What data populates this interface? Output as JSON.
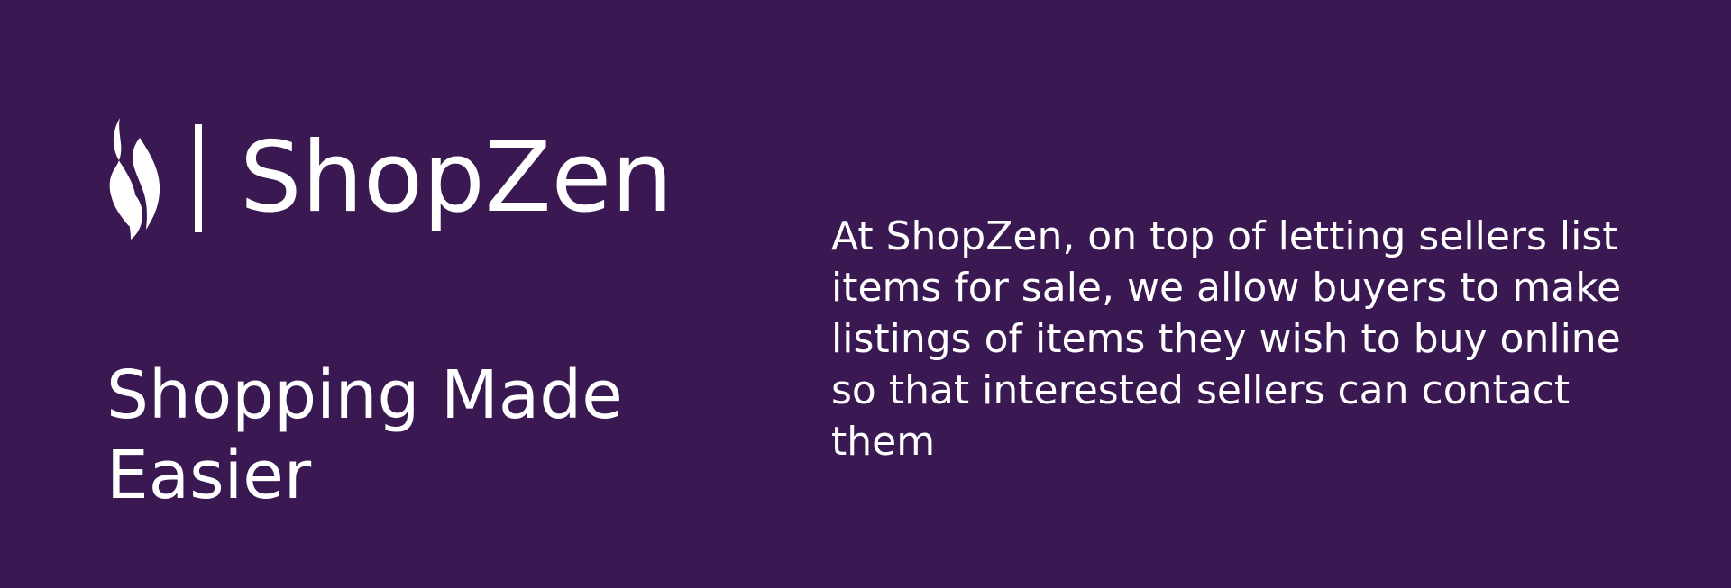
{
  "brand": {
    "name": "ShopZen",
    "logo_icon": "flame-icon"
  },
  "hero": {
    "tagline": "Shopping Made Easier",
    "description": "At ShopZen, on top of letting sellers list items for sale, we allow buyers to make listings of items they wish to buy online so that interested sellers can contact them"
  },
  "colors": {
    "background": "#3a1953",
    "text": "#ffffff"
  }
}
